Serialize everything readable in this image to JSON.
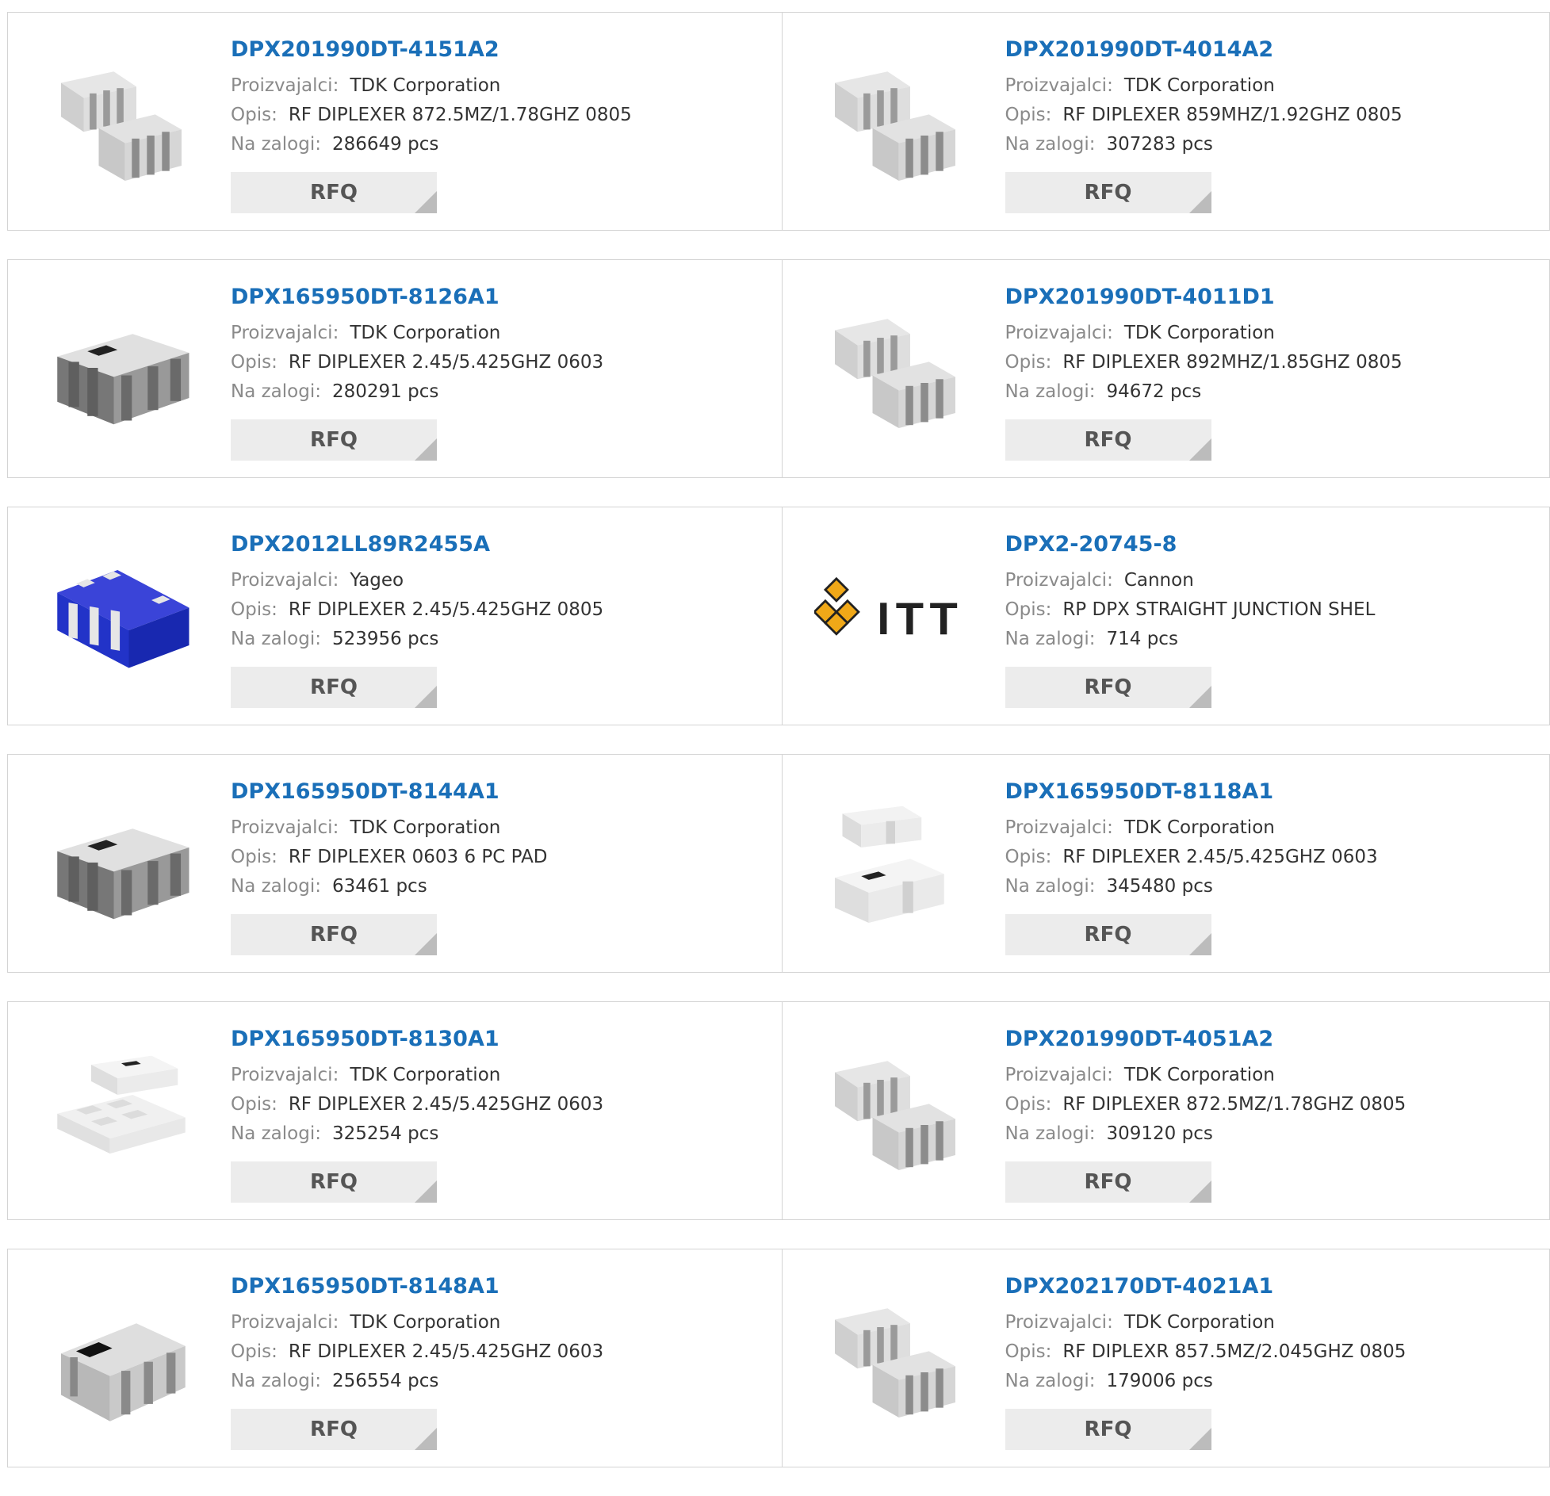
{
  "labels": {
    "manufacturer": "Proizvajalci:",
    "description": "Opis:",
    "stock": "Na zalogi:",
    "rfq": "RFQ"
  },
  "products": [
    {
      "part": "DPX201990DT-4151A2",
      "manufacturer": "TDK Corporation",
      "description": "RF DIPLEXER 872.5MZ/1.78GHZ 0805",
      "stock": "286649 pcs",
      "image": "chip-pair-gray"
    },
    {
      "part": "DPX201990DT-4014A2",
      "manufacturer": "TDK Corporation",
      "description": "RF DIPLEXER 859MHZ/1.92GHZ 0805",
      "stock": "307283 pcs",
      "image": "chip-pair-gray"
    },
    {
      "part": "DPX165950DT-8126A1",
      "manufacturer": "TDK Corporation",
      "description": "RF DIPLEXER 2.45/5.425GHZ 0603",
      "stock": "280291 pcs",
      "image": "chip-dark-gray"
    },
    {
      "part": "DPX201990DT-4011D1",
      "manufacturer": "TDK Corporation",
      "description": "RF DIPLEXER 892MHZ/1.85GHZ 0805",
      "stock": "94672 pcs",
      "image": "chip-pair-gray"
    },
    {
      "part": "DPX2012LL89R2455A",
      "manufacturer": "Yageo",
      "description": "RF DIPLEXER 2.45/5.425GHZ 0805",
      "stock": "523956 pcs",
      "image": "chip-blue"
    },
    {
      "part": "DPX2-20745-8",
      "manufacturer": "Cannon",
      "description": "RP DPX STRAIGHT JUNCTION SHEL",
      "stock": "714 pcs",
      "image": "itt-logo"
    },
    {
      "part": "DPX165950DT-8144A1",
      "manufacturer": "TDK Corporation",
      "description": "RF DIPLEXER 0603 6 PC PAD",
      "stock": "63461 pcs",
      "image": "chip-dark-gray"
    },
    {
      "part": "DPX165950DT-8118A1",
      "manufacturer": "TDK Corporation",
      "description": "RF DIPLEXER 2.45/5.425GHZ 0603",
      "stock": "345480 pcs",
      "image": "chip-pair-white"
    },
    {
      "part": "DPX165950DT-8130A1",
      "manufacturer": "TDK Corporation",
      "description": "RF DIPLEXER 2.45/5.425GHZ 0603",
      "stock": "325254 pcs",
      "image": "chip-pair-white-flat"
    },
    {
      "part": "DPX201990DT-4051A2",
      "manufacturer": "TDK Corporation",
      "description": "RF DIPLEXER 872.5MZ/1.78GHZ 0805",
      "stock": "309120 pcs",
      "image": "chip-pair-gray"
    },
    {
      "part": "DPX165950DT-8148A1",
      "manufacturer": "TDK Corporation",
      "description": "RF DIPLEXER 2.45/5.425GHZ 0603",
      "stock": "256554 pcs",
      "image": "chip-single-gray"
    },
    {
      "part": "DPX202170DT-4021A1",
      "manufacturer": "TDK Corporation",
      "description": "RF DIPLEXR 857.5MZ/2.045GHZ 0805",
      "stock": "179006 pcs",
      "image": "chip-pair-gray"
    }
  ],
  "colors": {
    "title": "#1a6fb8",
    "border": "#d4d4d4",
    "rfq_bg": "#ececec",
    "itt_gold": "#f0a818"
  }
}
